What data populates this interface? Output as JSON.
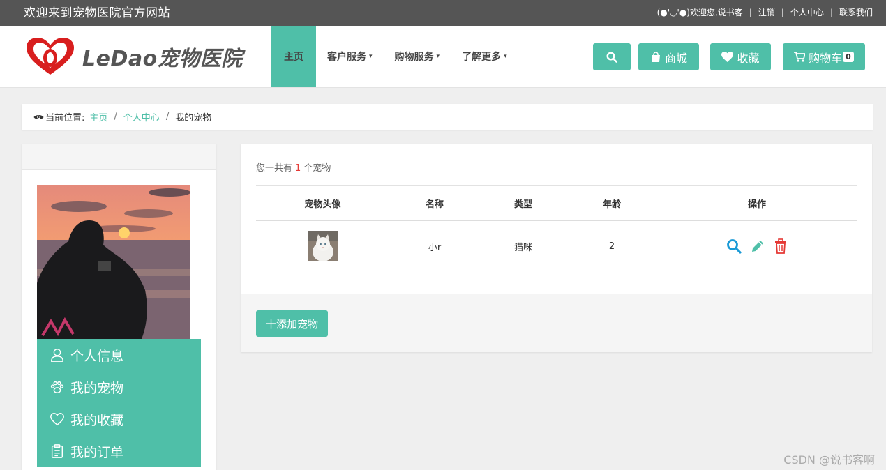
{
  "topbar": {
    "welcome": "欢迎来到宠物医院官方网站",
    "greeting": "(●'◡'●)欢迎您,说书客",
    "links": [
      "注销",
      "个人中心",
      "联系我们"
    ]
  },
  "header": {
    "logo_text": "LeDao宠物医院",
    "nav": [
      {
        "label": "主页",
        "active": true
      },
      {
        "label": "客户服务",
        "caret": "▾"
      },
      {
        "label": "购物服务",
        "caret": "▾"
      },
      {
        "label": "了解更多",
        "caret": "▾"
      }
    ],
    "buttons": {
      "mall": "商城",
      "favorites": "收藏",
      "cart": "购物车",
      "cart_count": "0"
    }
  },
  "breadcrumb": {
    "prefix": "当前位置:",
    "items": [
      "主页",
      "个人中心",
      "我的宠物"
    ]
  },
  "sidebar": {
    "menu": [
      "个人信息",
      "我的宠物",
      "我的收藏",
      "我的订单"
    ]
  },
  "main": {
    "summary_before": "您一共有",
    "summary_count": "1",
    "summary_after": "个宠物",
    "columns": [
      "宠物头像",
      "名称",
      "类型",
      "年龄",
      "操作"
    ],
    "rows": [
      {
        "name": "小r",
        "type": "猫咪",
        "age": "2"
      }
    ],
    "add_button": "十添加宠物"
  },
  "watermark": "CSDN @说书客啊",
  "colors": {
    "accent": "#4fbfa8",
    "topbar": "#555555",
    "view_icon": "#1a9ad6",
    "edit_icon": "#4fbfa8",
    "delete_icon": "#e53935"
  }
}
